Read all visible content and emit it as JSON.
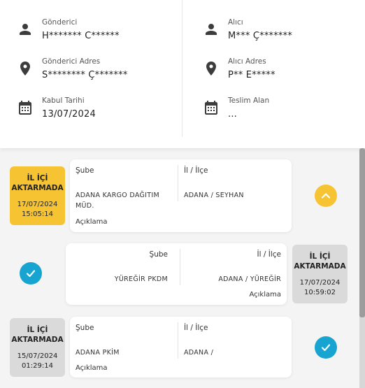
{
  "shipment": {
    "sender_label": "Gönderici",
    "sender_value": "H******* C******",
    "sender_address_label": "Gönderici Adres",
    "sender_address_value": "S******** Ç*******",
    "accept_date_label": "Kabul Tarihi",
    "accept_date_value": "13/07/2024",
    "receiver_label": "Alıcı",
    "receiver_value": "M*** Ç*******",
    "receiver_address_label": "Alıcı Adres",
    "receiver_address_value": "P** E*****",
    "delivered_to_label": "Teslim Alan",
    "delivered_to_value": "..."
  },
  "timeline": [
    {
      "status_line1": "İL İÇİ",
      "status_line2": "AKTARMADA",
      "date": "17/07/2024",
      "time": "15:05:14",
      "branch_label": "Şube",
      "branch_value_line1": "ADANA KARGO DAĞITIM",
      "branch_value_line2": "MÜD.",
      "district_label": "İl / İlçe",
      "district_value": "ADANA / SEYHAN",
      "description_label": "Açıklama",
      "badge_color": "#f6c433",
      "marker": "chevron-up-icon"
    },
    {
      "status_line1": "İL İÇİ",
      "status_line2": "AKTARMADA",
      "date": "17/07/2024",
      "time": "10:59:02",
      "branch_label": "Şube",
      "branch_value_line1": "YÜREĞİR PKDM",
      "district_label": "İl / İlçe",
      "district_value": "ADANA / YÜREĞİR",
      "description_label": "Açıklama",
      "badge_color": "#dadada",
      "marker": "check-icon"
    },
    {
      "status_line1": "İL İÇİ",
      "status_line2": "AKTARMADA",
      "date": "15/07/2024",
      "time": "01:29:14",
      "branch_label": "Şube",
      "branch_value_line1": "ADANA PKİM",
      "district_label": "İl / İlçe",
      "district_value": "ADANA /",
      "description_label": "Açıklama",
      "badge_color": "#dadada",
      "marker": "check-icon"
    }
  ],
  "colors": {
    "accent_yellow": "#f6c433",
    "accent_blue": "#18a4d0",
    "badge_gray": "#dadada"
  }
}
